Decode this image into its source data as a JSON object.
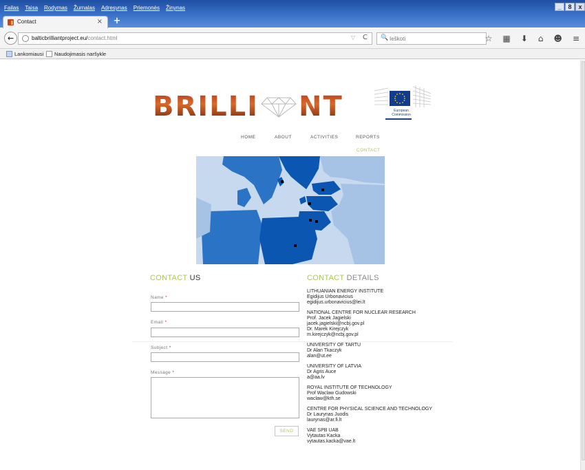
{
  "browser": {
    "menu": [
      "Failas",
      "Taisa",
      "Rodymas",
      "Žurnalas",
      "Adresynas",
      "Priemonės",
      "Žinynas"
    ],
    "window_controls": [
      "_",
      "8",
      "x"
    ],
    "tab_title": "Contact",
    "tab_close": "×",
    "new_tab": "+",
    "back": "←",
    "url_host": "balticbrilliantproject.eu/",
    "url_path": "contact.html",
    "url_dropdown": "▽",
    "reload": "C",
    "search_icon": "🔍",
    "search_placeholder": "Ieškoti",
    "toolbar_icons": [
      "☆",
      "▦",
      "⬇",
      "⌂",
      "☻",
      "≡"
    ],
    "bookmarks": [
      "Lankomiausi",
      "Naudojimasis naršykle"
    ]
  },
  "site": {
    "logo_left": "BRILLI",
    "logo_right": "NT",
    "ec_label_1": "European",
    "ec_label_2": "Commission",
    "nav": [
      "HOME",
      "ABOUT",
      "ACTIVITIES",
      "REPORTS"
    ],
    "nav_active": "CONTACT",
    "contact_us_title_a": "CONTACT",
    "contact_us_title_b": "US",
    "contact_details_title_a": "CONTACT",
    "contact_details_title_b": "DETAILS",
    "form": {
      "name_label": "Name",
      "email_label": "Email",
      "subject_label": "Subject",
      "message_label": "Message",
      "required_mark": "*",
      "send": "SEND"
    },
    "contacts": [
      {
        "org": "LITHUANIAN ENERGY INSTITUTE",
        "lines": [
          "Egidijus Urbonavicius",
          "egidijus.urbonavicius@lei.lt"
        ]
      },
      {
        "org": "NATIONAL CENTRE FOR NUCLEAR RESEARCH",
        "lines": [
          "Prof. Jacek Jagielski",
          "jacek.jagielski@ncbj.gov.pl",
          "Dr. Marek Kirejczyk",
          "m.kirejczyk@ncbj.gov.pl"
        ]
      },
      {
        "org": "UNIVERSITY OF TARTU",
        "lines": [
          "Dr Alan Tkaczyk",
          "alan@ut.ee"
        ]
      },
      {
        "org": "UNIVERSITY OF LATVIA",
        "lines": [
          "Dr Agris Auce",
          "a@aa.lv"
        ]
      },
      {
        "org": "ROYAL INSTITUTE OF TECHNOLOGY",
        "lines": [
          "Prof Waclaw Gudowski",
          "waclaw@kth.se"
        ]
      },
      {
        "org": "CENTRE FOR PHYSICAL SCIENCE AND TECHNOLOGY",
        "lines": [
          "Dr Laurynas Juodis",
          "laurynas@ar.fi.lt"
        ]
      },
      {
        "org": "VAE SPB UAB",
        "lines": [
          "Vytautas Kacka",
          "vytautas.kacka@vae.lt"
        ]
      }
    ]
  },
  "colors": {
    "accent_green": "#a8c957",
    "map_blue": "#0a56b0",
    "titlebar_blue": "#3a72c8"
  }
}
